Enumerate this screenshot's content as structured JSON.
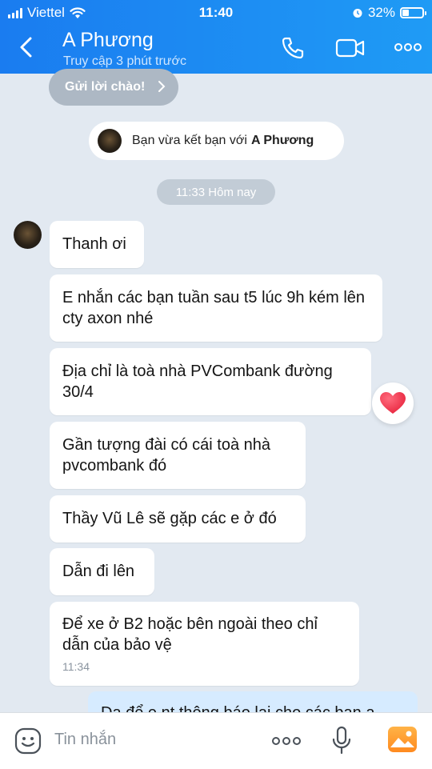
{
  "status_bar": {
    "carrier": "Viettel",
    "time": "11:40",
    "battery_percent": "32%",
    "battery_level": 0.32
  },
  "header": {
    "title": "A Phương",
    "subtitle": "Truy cập 3 phút trước"
  },
  "greeting_button": {
    "label": "Gửi lời chào!"
  },
  "friend_note": {
    "prefix": "Bạn vừa kết bạn với",
    "name": "A Phương"
  },
  "time_divider": "11:33 Hôm nay",
  "messages": [
    {
      "text": "Thanh ơi"
    },
    {
      "text": "E nhắn các bạn tuần sau t5 lúc 9h kém lên cty axon nhé"
    },
    {
      "text": "Địa chỉ là toà nhà PVCombank đường 30/4"
    },
    {
      "text": "Gần tượng đài có cái toà nhà pvcombank đó"
    },
    {
      "text": "Thầy Vũ Lê sẽ gặp các e ở đó"
    },
    {
      "text": "Dẫn đi lên"
    },
    {
      "text": "Để xe ở B2 hoặc bên ngoài theo chỉ dẫn của bảo vệ",
      "time": "11:34"
    }
  ],
  "outgoing_partial": "Dạ để e nt thông báo lại cho các bạn ạ",
  "composer": {
    "placeholder": "Tin nhắn"
  },
  "colors": {
    "header_start": "#1a7cf0",
    "header_end": "#1f9bf5",
    "background": "#e2e9f1",
    "outgoing_bubble": "#d6ebff",
    "heart": "#e8263f"
  },
  "icons": [
    "back-chevron-icon",
    "phone-icon",
    "video-call-icon",
    "more-icon",
    "sticker-icon",
    "more-options-icon",
    "microphone-icon",
    "image-icon",
    "heart-icon"
  ]
}
